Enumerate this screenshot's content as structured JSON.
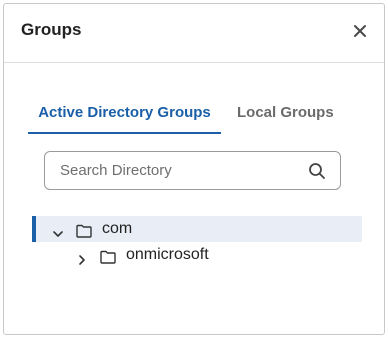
{
  "dialog": {
    "title": "Groups",
    "close_icon": "close-icon"
  },
  "tabs": [
    {
      "label": "Active Directory Groups",
      "active": true
    },
    {
      "label": "Local Groups",
      "active": false
    }
  ],
  "search": {
    "placeholder": "Search Directory",
    "value": "",
    "icon": "search-icon"
  },
  "tree": {
    "nodes": [
      {
        "label": "com",
        "expanded": true,
        "selected": true,
        "icon": "folder-icon"
      },
      {
        "label": "onmicrosoft",
        "expanded": false,
        "selected": false,
        "icon": "folder-icon"
      }
    ]
  },
  "colors": {
    "accent": "#1a5fa8",
    "selected_row": "#e9eef6",
    "border": "#c8c8c8"
  }
}
